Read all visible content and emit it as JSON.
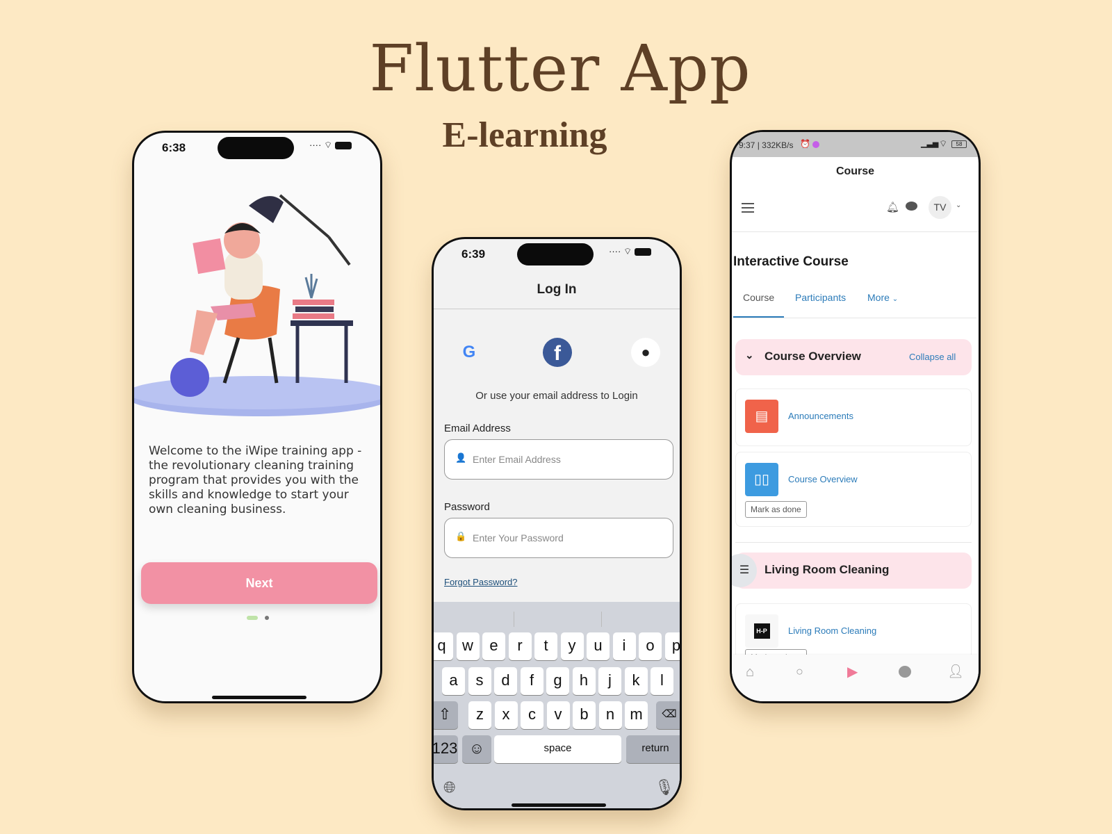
{
  "title": "Flutter App",
  "subtitle": "E-learning",
  "onboarding": {
    "time": "6:38",
    "welcome_text": "Welcome to the iWipe training app - the revolutionary cleaning training program that provides you with the skills and knowledge to start your own cleaning business.",
    "next_label": "Next",
    "page_index": 0,
    "page_count": 2,
    "accent": "#f291a4"
  },
  "login": {
    "time": "6:39",
    "title": "Log In",
    "social": [
      "google-icon",
      "facebook-icon",
      "apple-icon"
    ],
    "alt_text": "Or use your email address to Login",
    "email_label": "Email Address",
    "email_placeholder": "Enter Email Address",
    "password_label": "Password",
    "password_placeholder": "Enter Your Password",
    "forgot_label": "Forgot Password?",
    "keyboard": {
      "row1": [
        "q",
        "w",
        "e",
        "r",
        "t",
        "y",
        "u",
        "i",
        "o",
        "p"
      ],
      "row2": [
        "a",
        "s",
        "d",
        "f",
        "g",
        "h",
        "j",
        "k",
        "l"
      ],
      "row3": [
        "z",
        "x",
        "c",
        "v",
        "b",
        "n",
        "m"
      ],
      "numbers": "123",
      "space": "space",
      "return": "return"
    }
  },
  "course": {
    "status": "9:37 | 332KB/s",
    "battery": "58",
    "header_title": "Course",
    "avatar": "TV",
    "course_title": "Interactive Course",
    "tabs": [
      "Course",
      "Participants",
      "More"
    ],
    "section1": {
      "title": "Course Overview",
      "action": "Collapse all"
    },
    "items": [
      {
        "label": "Announcements",
        "icon": "announcement-icon",
        "color": "#f0634a"
      },
      {
        "label": "Course Overview",
        "icon": "book-icon",
        "color": "#3d9be0",
        "button": "Mark as done"
      }
    ],
    "section2": {
      "title": "Living Room Cleaning"
    },
    "item3": {
      "label": "Living Room Cleaning",
      "logo": "H-P",
      "button": "Mark as done"
    },
    "nav": [
      "home-icon",
      "search-icon",
      "play-icon",
      "chat-icon",
      "profile-icon"
    ],
    "nav_active": "#f07a98"
  }
}
